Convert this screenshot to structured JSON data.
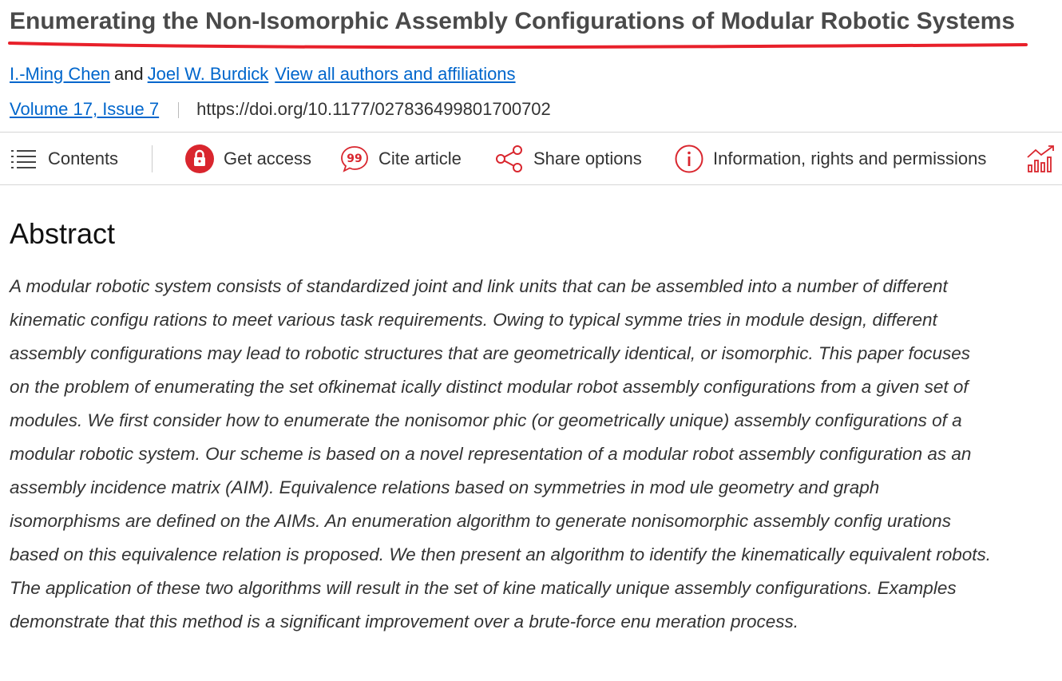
{
  "article": {
    "title": "Enumerating the Non-Isomorphic Assembly Configurations of Modular Robotic Systems",
    "authors": [
      {
        "name": "I.-Ming Chen"
      },
      {
        "name": "Joel W. Burdick"
      }
    ],
    "author_separator": "and",
    "all_authors_link": "View all authors and affiliations",
    "volume_issue": "Volume 17, Issue 7",
    "doi": "https://doi.org/10.1177/027836499801700702"
  },
  "toolbar": {
    "contents_label": "Contents",
    "get_access_label": "Get access",
    "cite_label": "Cite article",
    "share_label": "Share options",
    "info_label": "Information, rights and permissions"
  },
  "abstract": {
    "heading": "Abstract",
    "text": "A modular robotic system consists of standardized joint and link units that can be assembled into a number of different kinematic configu rations to meet various task requirements. Owing to typical symme tries in module design, different assembly configurations may lead to robotic structures that are geometrically identical, or isomorphic. This paper focuses on the problem of enumerating the set ofkinemat ically distinct modular robot assembly configurations from a given set of modules. We first consider how to enumerate the nonisomor phic (or geometrically unique) assembly configurations of a modular robotic system. Our scheme is based on a novel representation of a modular robot assembly configuration as an assembly incidence matrix (AIM). Equivalence relations based on symmetries in mod ule geometry and graph isomorphisms are defined on the AIMs. An enumeration algorithm to generate nonisomorphic assembly config urations based on this equivalence relation is proposed. We then present an algorithm to identify the kinematically equivalent robots. The application of these two algorithms will result in the set of kine matically unique assembly configurations. Examples demonstrate that this method is a significant improvement over a brute-force enu meration process."
  },
  "colors": {
    "link": "#0066cc",
    "accent_red": "#d9262e",
    "underline_red": "#e8202a"
  },
  "icons": [
    "list-icon",
    "lock-icon",
    "quote-icon",
    "share-icon",
    "info-icon",
    "metrics-icon"
  ]
}
